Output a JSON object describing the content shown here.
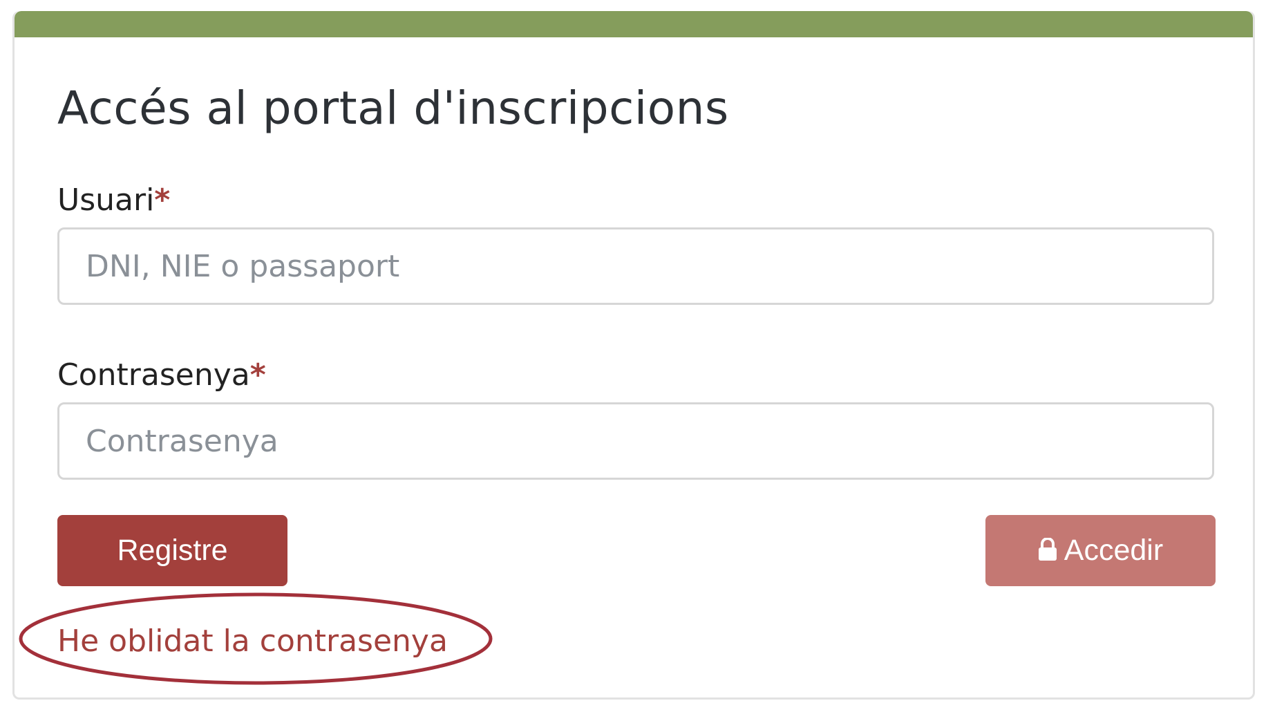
{
  "header": {
    "bar_color": "#859d5c"
  },
  "form": {
    "title": "Accés al portal d'inscripcions",
    "required_marker": "*",
    "username": {
      "label": "Usuari",
      "placeholder": "DNI, NIE o passaport",
      "value": ""
    },
    "password": {
      "label": "Contrasenya",
      "placeholder": "Contrasenya",
      "value": ""
    }
  },
  "buttons": {
    "register_label": "Registre",
    "access_label": "Accedir",
    "access_icon": "lock-icon",
    "register_color": "#a3403c",
    "access_color": "#c47873"
  },
  "links": {
    "forgot_password": "He oblidat la contrasenya"
  },
  "annotation": {
    "highlight_color": "#a3403c"
  }
}
